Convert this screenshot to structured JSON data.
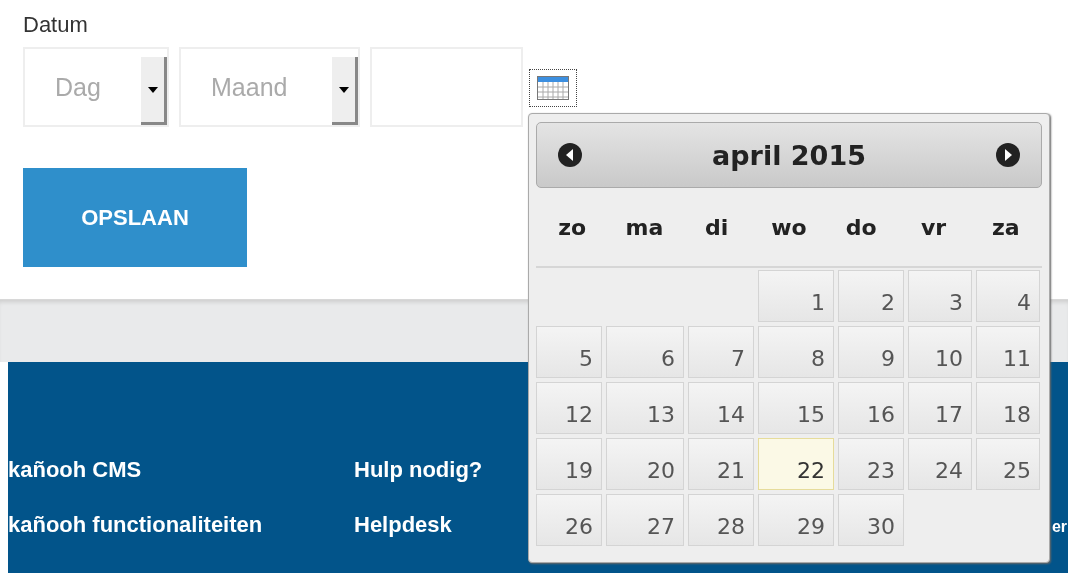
{
  "form": {
    "label": "Datum",
    "day_select": {
      "placeholder": "Dag"
    },
    "month_select": {
      "placeholder": "Maand"
    },
    "save_button": "OPSLAAN"
  },
  "datepicker": {
    "title": "april 2015",
    "weekdays": [
      "zo",
      "ma",
      "di",
      "wo",
      "do",
      "vr",
      "za"
    ],
    "days": [
      {
        "kind": "blank"
      },
      {
        "kind": "blank"
      },
      {
        "kind": "blank"
      },
      {
        "kind": "day",
        "label": "1",
        "selected": false
      },
      {
        "kind": "day",
        "label": "2",
        "selected": false
      },
      {
        "kind": "day",
        "label": "3",
        "selected": false
      },
      {
        "kind": "day",
        "label": "4",
        "selected": false
      },
      {
        "kind": "day",
        "label": "5",
        "selected": false
      },
      {
        "kind": "day",
        "label": "6",
        "selected": false
      },
      {
        "kind": "day",
        "label": "7",
        "selected": false
      },
      {
        "kind": "day",
        "label": "8",
        "selected": false
      },
      {
        "kind": "day",
        "label": "9",
        "selected": false
      },
      {
        "kind": "day",
        "label": "10",
        "selected": false
      },
      {
        "kind": "day",
        "label": "11",
        "selected": false
      },
      {
        "kind": "day",
        "label": "12",
        "selected": false
      },
      {
        "kind": "day",
        "label": "13",
        "selected": false
      },
      {
        "kind": "day",
        "label": "14",
        "selected": false
      },
      {
        "kind": "day",
        "label": "15",
        "selected": false
      },
      {
        "kind": "day",
        "label": "16",
        "selected": false
      },
      {
        "kind": "day",
        "label": "17",
        "selected": false
      },
      {
        "kind": "day",
        "label": "18",
        "selected": false
      },
      {
        "kind": "day",
        "label": "19",
        "selected": false
      },
      {
        "kind": "day",
        "label": "20",
        "selected": false
      },
      {
        "kind": "day",
        "label": "21",
        "selected": false
      },
      {
        "kind": "day",
        "label": "22",
        "selected": true
      },
      {
        "kind": "day",
        "label": "23",
        "selected": false
      },
      {
        "kind": "day",
        "label": "24",
        "selected": false
      },
      {
        "kind": "day",
        "label": "25",
        "selected": false
      },
      {
        "kind": "day",
        "label": "26",
        "selected": false
      },
      {
        "kind": "day",
        "label": "27",
        "selected": false
      },
      {
        "kind": "day",
        "label": "28",
        "selected": false
      },
      {
        "kind": "day",
        "label": "29",
        "selected": false
      },
      {
        "kind": "day",
        "label": "30",
        "selected": false
      }
    ]
  },
  "footer": {
    "columns": [
      [
        "kañooh CMS",
        "kañooh functionaliteiten"
      ],
      [
        "Hulp nodig?",
        "Helpdesk"
      ]
    ],
    "column_3": "er"
  }
}
